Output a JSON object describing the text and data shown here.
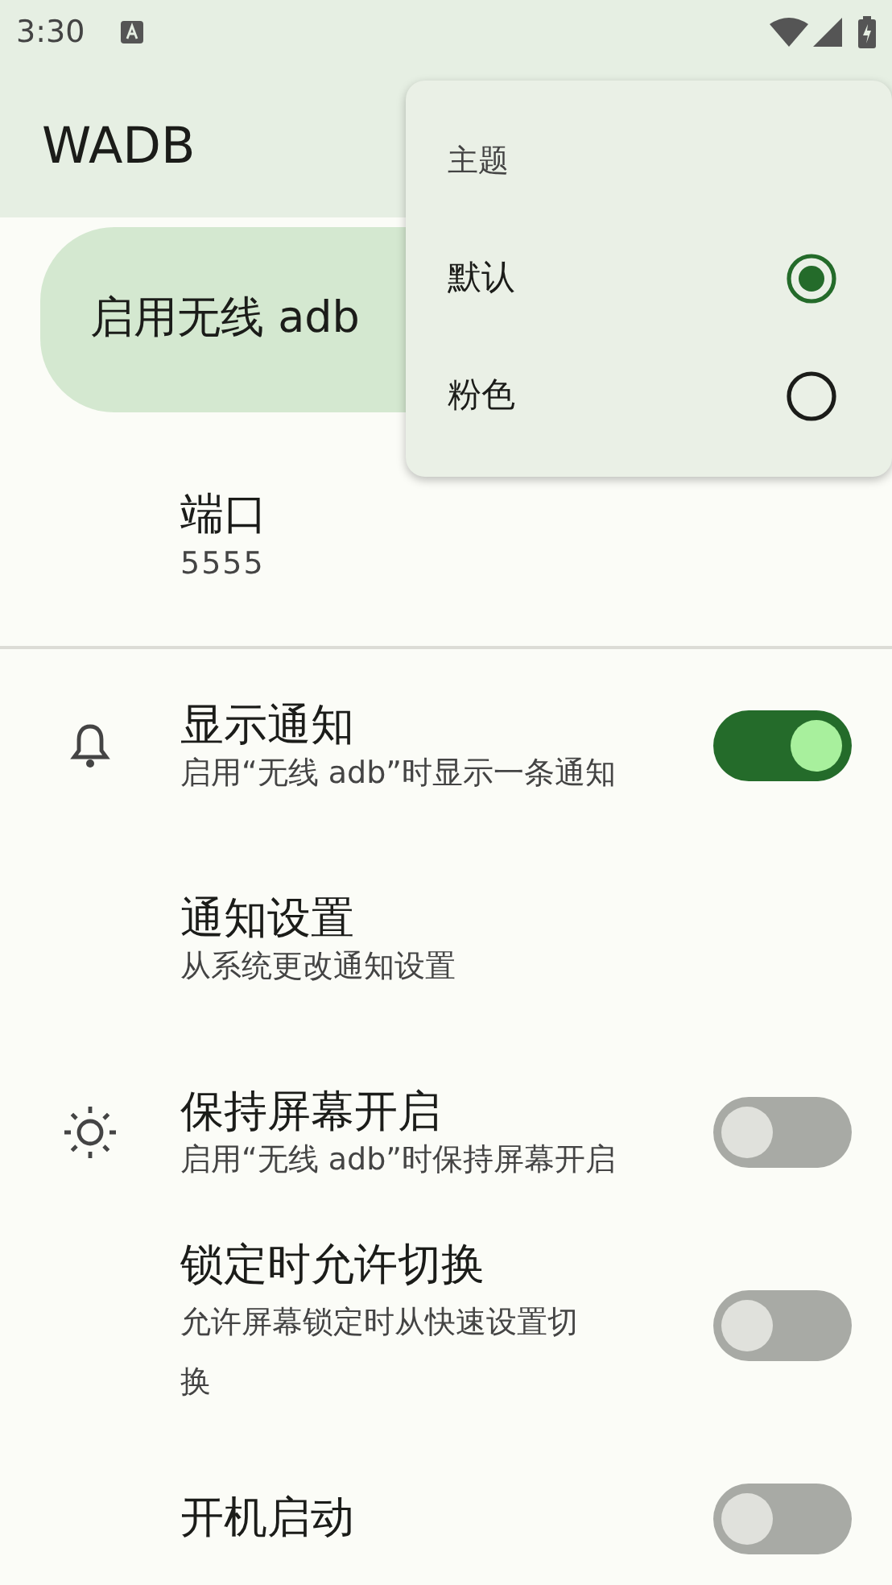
{
  "status_bar": {
    "time": "3:30"
  },
  "app_bar": {
    "title": "WADB"
  },
  "enable_card": {
    "label": "启用无线 adb"
  },
  "port": {
    "title": "端口",
    "value": "5555"
  },
  "settings": [
    {
      "title": "显示通知",
      "summary": "启用“无线 adb”时显示一条通知",
      "kind": "toggle",
      "on": true
    },
    {
      "title": "通知设置",
      "summary": "从系统更改通知设置",
      "kind": "link"
    },
    {
      "title": "保持屏幕开启",
      "summary": "启用“无线 adb”时保持屏幕开启",
      "kind": "toggle",
      "on": false
    },
    {
      "title": "锁定时允许切换",
      "summary": "允许屏幕锁定时从快速设置切换",
      "kind": "toggle",
      "on": false
    },
    {
      "title": "开机启动",
      "kind": "toggle",
      "on": false
    }
  ],
  "theme_menu": {
    "heading": "主题",
    "options": [
      {
        "label": "默认",
        "selected": true
      },
      {
        "label": "粉色",
        "selected": false
      }
    ]
  }
}
